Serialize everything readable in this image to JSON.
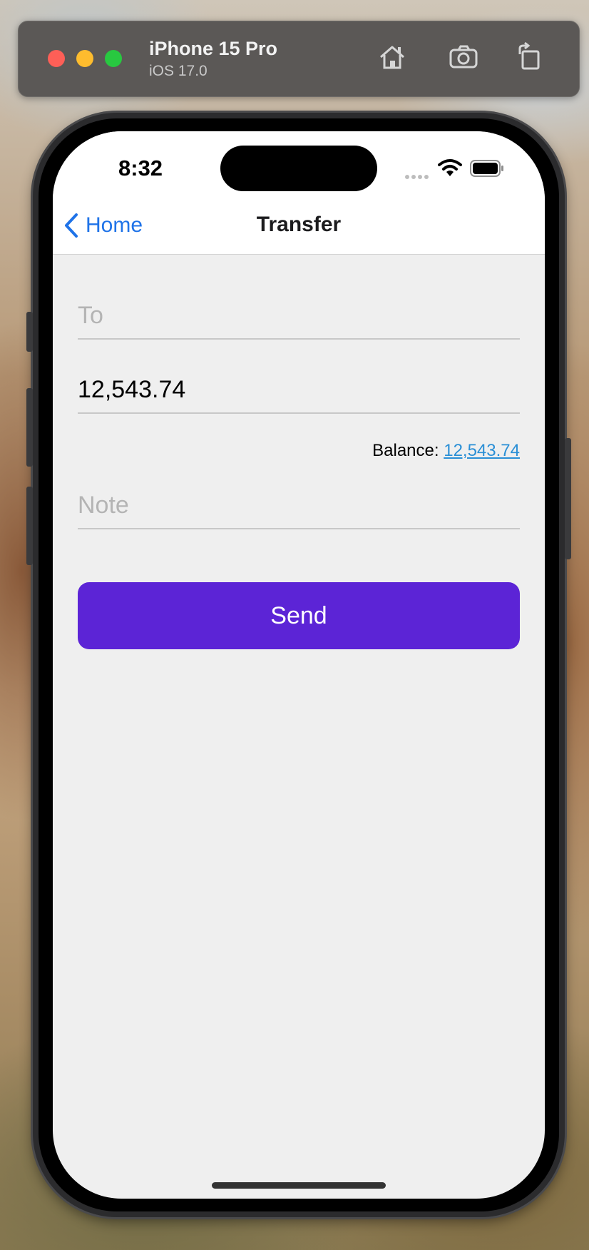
{
  "simulator": {
    "device_name": "iPhone 15 Pro",
    "os_version": "iOS 17.0",
    "buttons": [
      "home-icon",
      "screenshot-icon",
      "rotate-icon"
    ]
  },
  "status_bar": {
    "time": "8:32"
  },
  "nav": {
    "back_label": "Home",
    "title": "Transfer"
  },
  "form": {
    "to_placeholder": "To",
    "to_value": "",
    "amount_value": "12,543.74",
    "balance_label": "Balance:",
    "balance_value": "12,543.74",
    "note_placeholder": "Note",
    "note_value": "",
    "send_label": "Send"
  },
  "colors": {
    "accent": "#1f73e8",
    "send_button": "#5c24d6",
    "balance_link": "#2a8fd6"
  }
}
